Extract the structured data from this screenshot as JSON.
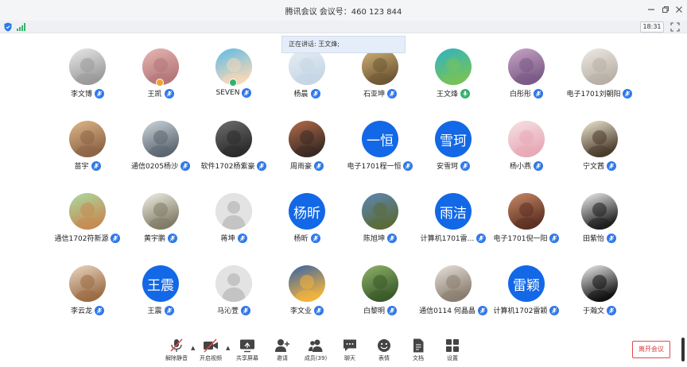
{
  "window": {
    "title": "腾讯会议 会议号：460 123 844"
  },
  "status": {
    "timer": "18:31"
  },
  "speaking_banner": "正在讲话: 王文烽;",
  "participants": [
    {
      "name": "李文博",
      "avatar": "photo",
      "colors": [
        "#e9e9e9",
        "#9a9a9a"
      ]
    },
    {
      "name": "王凯",
      "avatar": "photo",
      "colors": [
        "#e7b7b2",
        "#b4767a"
      ],
      "badge": "#f2a22b"
    },
    {
      "name": "SEVEN",
      "avatar": "photo",
      "colors": [
        "#5bbbe8",
        "#f3d7b8"
      ],
      "badge": "#34b26a"
    },
    {
      "name": "杨晨",
      "avatar": "photo",
      "colors": [
        "#e8eef5",
        "#c6d6e6"
      ]
    },
    {
      "name": "石亚坤",
      "avatar": "photo",
      "colors": [
        "#d4b47a",
        "#6e5734"
      ]
    },
    {
      "name": "王文烽",
      "avatar": "photo",
      "colors": [
        "#2fb3c4",
        "#76c25a"
      ],
      "mic_active": true
    },
    {
      "name": "白彤彤",
      "avatar": "photo",
      "colors": [
        "#c9a6c6",
        "#7a5a86"
      ]
    },
    {
      "name": "电子1701刘朝阳",
      "avatar": "photo",
      "colors": [
        "#eeeae4",
        "#b8b0a5"
      ]
    },
    {
      "name": "苗宇",
      "avatar": "photo",
      "colors": [
        "#e0b88a",
        "#8c6446"
      ]
    },
    {
      "name": "通信0205杨沙",
      "avatar": "photo",
      "colors": [
        "#cfd6dd",
        "#5c6670"
      ]
    },
    {
      "name": "软件1702杨紫豪",
      "avatar": "photo",
      "colors": [
        "#6e6e6e",
        "#2b2b2b"
      ]
    },
    {
      "name": "周雨豪",
      "avatar": "photo",
      "colors": [
        "#b56c4a",
        "#3a2a24"
      ]
    },
    {
      "name": "电子1701程一恒",
      "avatar": "text",
      "text": "一恒"
    },
    {
      "name": "安雪珂",
      "avatar": "text",
      "text": "雪珂"
    },
    {
      "name": "杨小燕",
      "avatar": "photo",
      "colors": [
        "#f6e2e6",
        "#e7a9b5"
      ]
    },
    {
      "name": "宁文茜",
      "avatar": "photo",
      "colors": [
        "#f0ead4",
        "#4a3b2b"
      ]
    },
    {
      "name": "通信1702符新源",
      "avatar": "photo",
      "colors": [
        "#a9dba0",
        "#c58b54"
      ]
    },
    {
      "name": "黄宇鹏",
      "avatar": "photo",
      "colors": [
        "#f2f0e6",
        "#7f7b66"
      ]
    },
    {
      "name": "蒋坤",
      "avatar": "default"
    },
    {
      "name": "杨昕",
      "avatar": "text",
      "text": "杨昕"
    },
    {
      "name": "陈旭坤",
      "avatar": "photo",
      "colors": [
        "#5d87b6",
        "#5a6b3a"
      ]
    },
    {
      "name": "计算机1701雷...",
      "avatar": "text",
      "text": "雨洁"
    },
    {
      "name": "电子1701倪一阳",
      "avatar": "photo",
      "colors": [
        "#c98a68",
        "#5c3022"
      ]
    },
    {
      "name": "田紫怡",
      "avatar": "photo",
      "colors": [
        "#f1f1f1",
        "#1e1e1e"
      ]
    },
    {
      "name": "李云龙",
      "avatar": "photo",
      "colors": [
        "#ead7c3",
        "#9b6c44"
      ]
    },
    {
      "name": "王震",
      "avatar": "text",
      "text": "王震"
    },
    {
      "name": "马沁萱",
      "avatar": "default"
    },
    {
      "name": "李文业",
      "avatar": "photo",
      "colors": [
        "#3461a8",
        "#f2b33d"
      ]
    },
    {
      "name": "白黎明",
      "avatar": "photo",
      "colors": [
        "#8fb46a",
        "#3b5a2a"
      ]
    },
    {
      "name": "通信0114 何晶晶",
      "avatar": "photo",
      "colors": [
        "#e7e2dc",
        "#8a7d6f"
      ]
    },
    {
      "name": "计算机1702雷颖",
      "avatar": "text",
      "text": "雷颖"
    },
    {
      "name": "于瀚文",
      "avatar": "photo",
      "colors": [
        "#f0f0f0",
        "#111111"
      ]
    }
  ],
  "toolbar": {
    "mute": "解除静音",
    "video": "开启视频",
    "share": "共享屏幕",
    "invite": "邀请",
    "members": "成员(39)",
    "chat": "聊天",
    "emoji": "表情",
    "docs": "文档",
    "apps": "设置",
    "leave": "离开会议"
  },
  "colors": {
    "accent": "#1268e6",
    "mic": "#2f78e8",
    "leave": "#d93a3a"
  }
}
